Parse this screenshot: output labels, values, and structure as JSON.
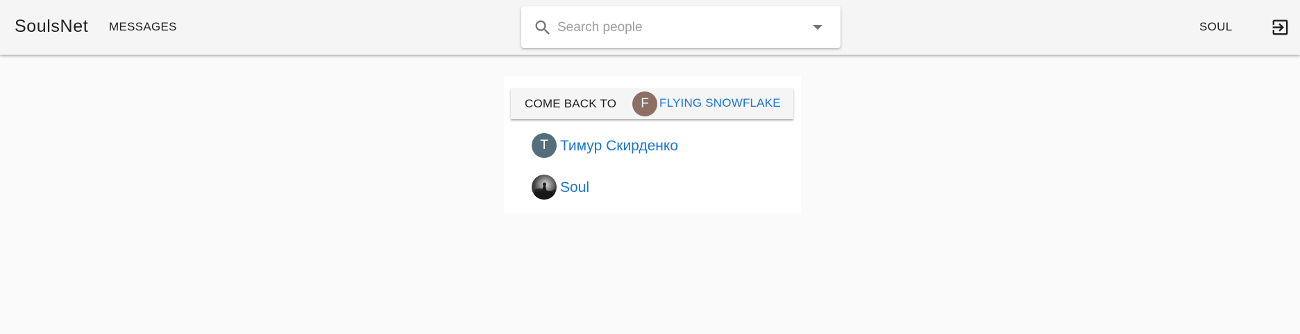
{
  "app": {
    "brand": "SoulsNet"
  },
  "nav": {
    "messages_label": "MESSAGES",
    "user_label": "SOUL",
    "logout_icon": "logout-icon"
  },
  "search": {
    "placeholder": "Search people",
    "value": "",
    "icon": "search-icon",
    "dropdown_icon": "dropdown-icon"
  },
  "comeback": {
    "label": "COME BACK TO",
    "avatar_initial": "F",
    "name": "FLYING SNOWFLAKE"
  },
  "people": [
    {
      "avatar_initial": "T",
      "name": "Тимур Скирденко",
      "avatar_kind": "initial"
    },
    {
      "avatar_initial": "",
      "name": "Soul",
      "avatar_kind": "photo"
    }
  ],
  "colors": {
    "accent": "#1976d2",
    "topbar": "#f5f5f5",
    "background": "#fafafa",
    "avatar_f": "#8d6e63",
    "avatar_t": "#546e7a"
  }
}
